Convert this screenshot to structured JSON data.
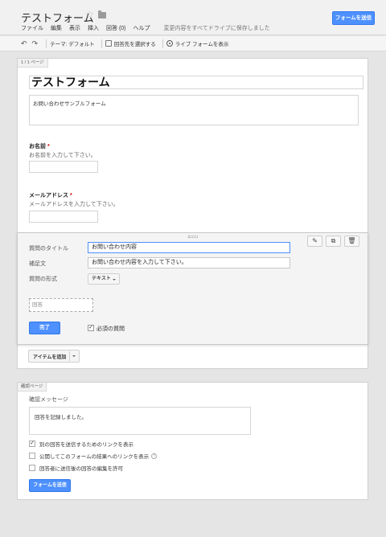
{
  "header": {
    "title": "テストフォーム",
    "menu": [
      "ファイル",
      "編集",
      "表示",
      "挿入",
      "回答 (0)",
      "ヘルプ"
    ],
    "save_status": "変更内容をすべてドライブに保存しました",
    "send_button": "フォームを送信"
  },
  "toolbar": {
    "undo": "↶",
    "redo": "↷",
    "theme": "テーマ: デフォルト",
    "choose_destination": "回答先を選択する",
    "view_live": "ライブ フォームを表示"
  },
  "page": {
    "label": "1 / 1 ページ",
    "form_title": "テストフォーム",
    "form_description": "お問い合わせサンプルフォーム"
  },
  "questions": [
    {
      "title": "お名前",
      "required_mark": "*",
      "help": "お名前を入力して下さい。"
    },
    {
      "title": "メールアドレス",
      "required_mark": "*",
      "help": "メールアドレスを入力して下さい。"
    }
  ],
  "editor": {
    "title_label": "質問のタイトル",
    "title_value": "お問い合わせ内容",
    "help_label": "補足文",
    "help_value": "お問い合わせ内容を入力して下さい。",
    "type_label": "質問の形式",
    "type_value": "テキスト",
    "answer_placeholder": "回答",
    "done_button": "完了",
    "required_label": "必須の質問",
    "required_checked": true
  },
  "add_item": {
    "label": "アイテムを追加"
  },
  "confirmation": {
    "page_label": "確認ページ",
    "message_label": "確認メッセージ",
    "message_value": "回答を記録しました。",
    "options": [
      {
        "label": "別の回答を送信するためのリンクを表示",
        "checked": true
      },
      {
        "label": "公開してこのフォームの結果へのリンクを表示",
        "checked": false,
        "help": "?"
      },
      {
        "label": "回答者に送信後の回答の編集を許可",
        "checked": false
      }
    ],
    "send_button": "フォームを送信"
  },
  "colors": {
    "accent": "#4d90fe",
    "required": "#dd0000"
  }
}
